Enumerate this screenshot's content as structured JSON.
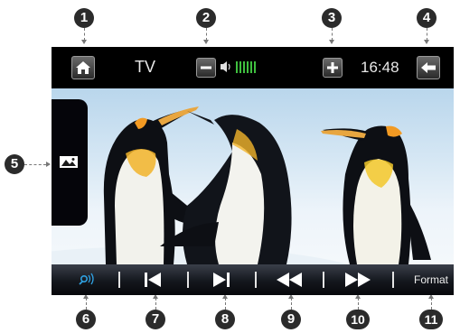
{
  "topbar": {
    "title": "TV",
    "clock": "16:48",
    "home_icon": "home-icon",
    "volume_down_icon": "minus-icon",
    "volume_up_icon": "plus-icon",
    "back_icon": "back-arrow-icon",
    "volume_level_bars": 6
  },
  "sidebar": {
    "picture_icon": "picture-mode-icon"
  },
  "bottombar": {
    "items": [
      {
        "icon": "search-signal-icon"
      },
      {
        "icon": "previous-track-icon"
      },
      {
        "icon": "next-track-icon"
      },
      {
        "icon": "rewind-icon"
      },
      {
        "icon": "fast-forward-icon"
      }
    ],
    "format_label": "Format"
  },
  "callouts": [
    "1",
    "2",
    "3",
    "4",
    "5",
    "6",
    "7",
    "8",
    "9",
    "10",
    "11"
  ],
  "colors": {
    "accent_blue": "#2fa0e0",
    "volume_green": "#3fbf3f",
    "callout_bg": "#2b2b2b"
  }
}
